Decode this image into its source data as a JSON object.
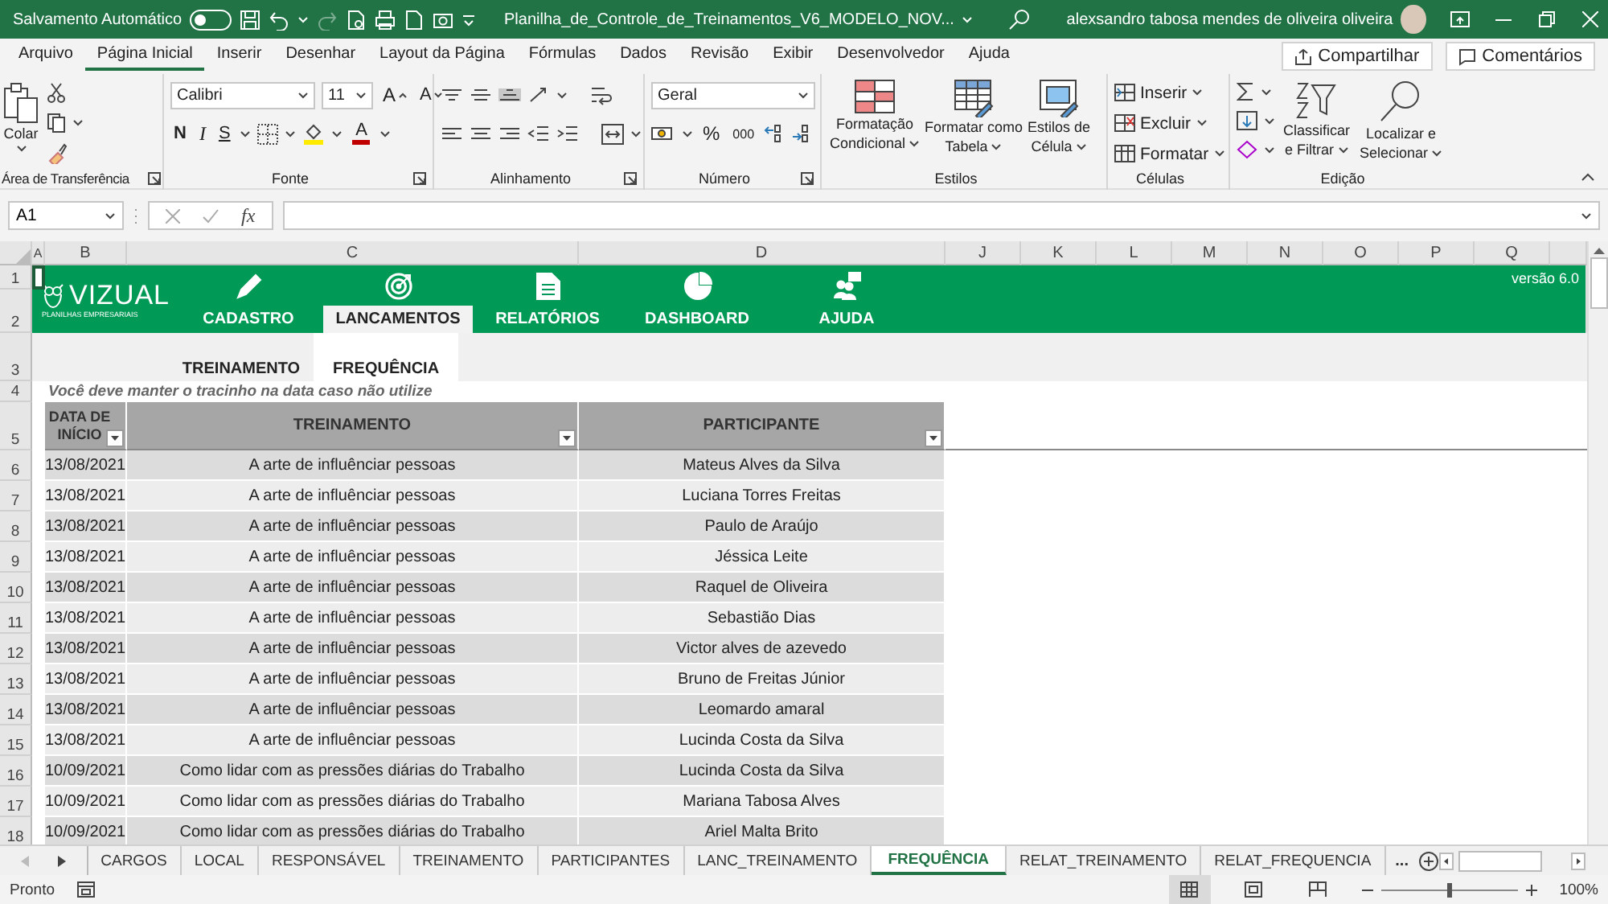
{
  "title_bar": {
    "autosave_label": "Salvamento Automático",
    "autosave_on": false,
    "redo_disabled": true,
    "title": "Planilha_de_Controle_de_Treinamentos_V6_MODELO_NOV...",
    "user": "alexsandro tabosa mendes de oliveira oliveira"
  },
  "ribbon": {
    "tabs": [
      {
        "label": "Arquivo",
        "selected": false
      },
      {
        "label": "Página Inicial",
        "selected": true
      },
      {
        "label": "Inserir",
        "selected": false
      },
      {
        "label": "Desenhar",
        "selected": false
      },
      {
        "label": "Layout da Página",
        "selected": false
      },
      {
        "label": "Fórmulas",
        "selected": false
      },
      {
        "label": "Dados",
        "selected": false
      },
      {
        "label": "Revisão",
        "selected": false
      },
      {
        "label": "Exibir",
        "selected": false
      },
      {
        "label": "Desenvolvedor",
        "selected": false
      },
      {
        "label": "Ajuda",
        "selected": false
      }
    ],
    "share": "Compartilhar",
    "comments": "Comentários",
    "clipboard": {
      "paste": "Colar",
      "group": "Área de Transferência"
    },
    "font": {
      "name": "Calibri",
      "size": "11",
      "grow": "A",
      "shrink": "A",
      "styles": [
        "N",
        "I",
        "S"
      ],
      "color_letter": "A",
      "group": "Fonte"
    },
    "alignment": {
      "group": "Alinhamento"
    },
    "number": {
      "format": "Geral",
      "percent": "%",
      "thousands": "000",
      "group": "Número"
    },
    "styles": {
      "buttons": [
        {
          "kind": "conditional",
          "lines": [
            "Formatação",
            "Condicional"
          ]
        },
        {
          "kind": "table",
          "lines": [
            "Formatar como",
            "Tabela"
          ]
        },
        {
          "kind": "cellstyle",
          "lines": [
            "Estilos de",
            "Célula"
          ]
        }
      ],
      "group": "Estilos"
    },
    "cells": {
      "buttons": [
        {
          "kind": "insert",
          "label": "Inserir"
        },
        {
          "kind": "delete",
          "label": "Excluir"
        },
        {
          "kind": "format",
          "label": "Formatar"
        }
      ],
      "group": "Células"
    },
    "editing": {
      "buttons": [
        {
          "kind": "sort",
          "lines": [
            "Classificar",
            "e Filtrar"
          ]
        },
        {
          "kind": "find",
          "lines": [
            "Localizar e",
            "Selecionar"
          ]
        }
      ],
      "group": "Edição"
    }
  },
  "formula_bar": {
    "name_box": "A1",
    "function_label": "fx"
  },
  "columns": [
    "A",
    "B",
    "C",
    "D",
    "J",
    "K",
    "L",
    "M",
    "N",
    "O",
    "P",
    "Q"
  ],
  "row_headers": [
    "1",
    "2",
    "3",
    "4",
    "5",
    "6",
    "7",
    "8",
    "9",
    "10",
    "11",
    "12",
    "13",
    "14",
    "15",
    "16",
    "17",
    "18"
  ],
  "header_band": {
    "logo": "VIZUAL",
    "tagline": "PLANILHAS EMPRESARIAIS",
    "version": "versão 6.0",
    "nav": [
      {
        "label": "CADASTRO",
        "kind": "pencil",
        "selected": false
      },
      {
        "label": "LANCAMENTOS",
        "kind": "target",
        "selected": true
      },
      {
        "label": "RELATÓRIOS",
        "kind": "document",
        "selected": false
      },
      {
        "label": "DASHBOARD",
        "kind": "pie",
        "selected": false
      },
      {
        "label": "AJUDA",
        "kind": "people",
        "selected": false
      }
    ]
  },
  "subtabs": [
    {
      "label": "TREINAMENTO",
      "selected": false
    },
    {
      "label": "FREQUÊNCIA",
      "selected": true
    }
  ],
  "note": "Você deve manter o tracinho na data caso não utilize",
  "table": {
    "columns": [
      "DATA DE INÍCIO",
      "TREINAMENTO",
      "PARTICIPANTE"
    ],
    "rows": [
      [
        "13/08/2021",
        "A arte de influênciar pessoas",
        "Mateus Alves da Silva"
      ],
      [
        "13/08/2021",
        "A arte de influênciar pessoas",
        "Luciana Torres Freitas"
      ],
      [
        "13/08/2021",
        "A arte de influênciar pessoas",
        "Paulo de Araújo"
      ],
      [
        "13/08/2021",
        "A arte de influênciar pessoas",
        "Jéssica Leite"
      ],
      [
        "13/08/2021",
        "A arte de influênciar pessoas",
        "Raquel de Oliveira"
      ],
      [
        "13/08/2021",
        "A arte de influênciar pessoas",
        "Sebastião Dias"
      ],
      [
        "13/08/2021",
        "A arte de influênciar pessoas",
        "Victor alves de azevedo"
      ],
      [
        "13/08/2021",
        "A arte de influênciar pessoas",
        "Bruno de Freitas Júnior"
      ],
      [
        "13/08/2021",
        "A arte de influênciar pessoas",
        "Leomardo amaral"
      ],
      [
        "13/08/2021",
        "A arte de influênciar pessoas",
        "Lucinda Costa da Silva"
      ],
      [
        "10/09/2021",
        "Como lidar com as pressões diárias do Trabalho",
        "Lucinda Costa da Silva"
      ],
      [
        "10/09/2021",
        "Como lidar com as pressões diárias do Trabalho",
        "Mariana Tabosa Alves"
      ],
      [
        "10/09/2021",
        "Como lidar com as pressões diárias do Trabalho",
        "Ariel Malta Brito"
      ]
    ]
  },
  "sheet_tabs": [
    {
      "label": "CARGOS",
      "selected": false
    },
    {
      "label": "LOCAL",
      "selected": false
    },
    {
      "label": "RESPONSÁVEL",
      "selected": false
    },
    {
      "label": "TREINAMENTO",
      "selected": false
    },
    {
      "label": "PARTICIPANTES",
      "selected": false
    },
    {
      "label": "LANC_TREINAMENTO",
      "selected": false
    },
    {
      "label": "FREQUÊNCIA",
      "selected": true
    },
    {
      "label": "RELAT_TREINAMENTO",
      "selected": false
    },
    {
      "label": "RELAT_FREQUENCIA",
      "selected": false
    }
  ],
  "more_tabs": "...",
  "status_bar": {
    "text": "Pronto",
    "zoom": "100%",
    "level": 0.5
  }
}
